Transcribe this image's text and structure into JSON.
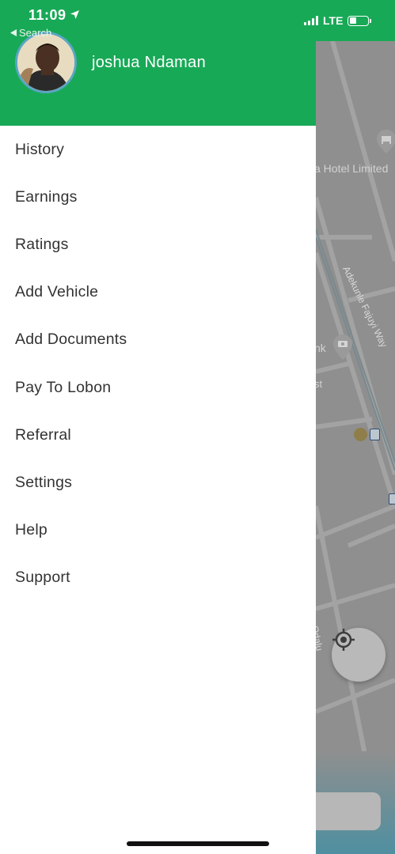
{
  "status_bar": {
    "time": "11:09",
    "back_label": "Search",
    "network": "LTE",
    "battery_level": 0.35
  },
  "drawer": {
    "user_name": "joshua Ndaman",
    "menu": [
      {
        "label": "History",
        "icon": ""
      },
      {
        "label": "Earnings",
        "icon": ""
      },
      {
        "label": "Ratings",
        "icon": ""
      },
      {
        "label": "Add Vehicle",
        "icon": ""
      },
      {
        "label": "Add Documents",
        "icon": ""
      },
      {
        "label": "Pay To Lobon",
        "icon": ""
      },
      {
        "label": "Referral",
        "icon": ""
      },
      {
        "label": "Settings",
        "icon": ""
      },
      {
        "label": "Help",
        "icon": ""
      },
      {
        "label": "Support",
        "icon": ""
      }
    ]
  },
  "map": {
    "labels": {
      "hotel": "a Hotel Limited",
      "street": "Adekunle Fajuyi Way",
      "bank": "nk",
      "fragment_st": "st",
      "fragment_odal": "Odalu"
    }
  },
  "colors": {
    "brand_green": "#18a957",
    "map_gray": "#8f8f8f",
    "text_dark": "#333333"
  }
}
